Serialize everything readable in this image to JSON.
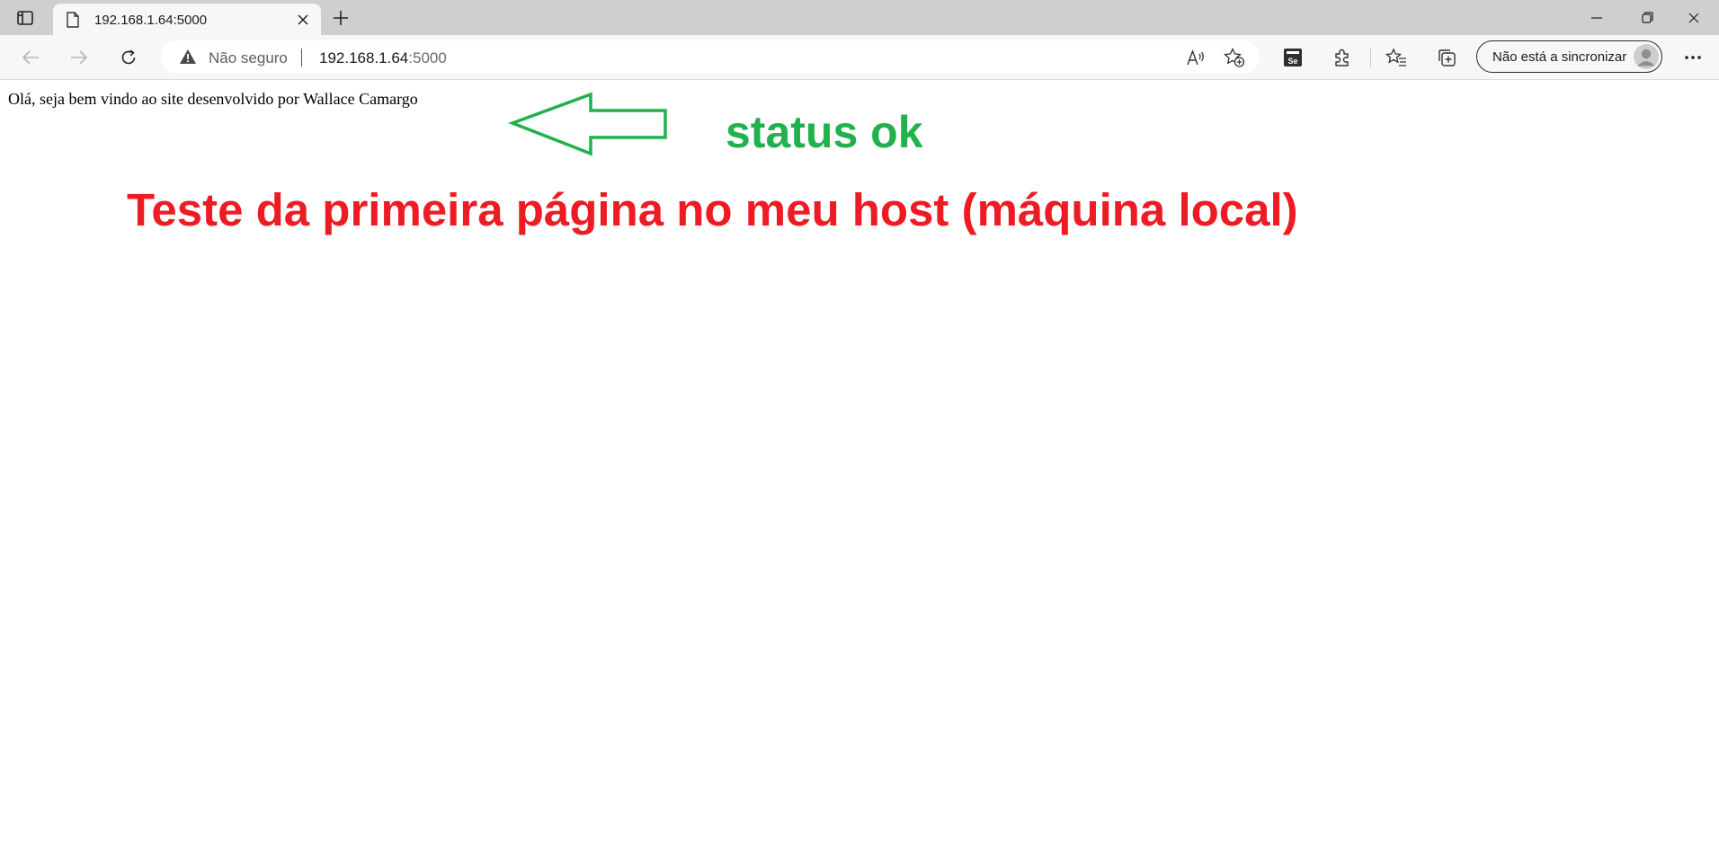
{
  "browser": {
    "tab": {
      "title": "192.168.1.64:5000"
    },
    "address_bar": {
      "security_label": "Não seguro",
      "url_host": "192.168.1.64",
      "url_port": ":5000"
    },
    "sync_button": {
      "label": "Não está a sincronizar"
    },
    "icons": {
      "tab_actions": "tab-actions-icon",
      "favicon": "page-icon",
      "tab_close": "close-icon",
      "new_tab": "plus-icon",
      "back": "back-arrow-icon",
      "forward": "forward-arrow-icon",
      "refresh": "refresh-icon",
      "warning": "warning-icon",
      "read_aloud": "read-aloud-icon",
      "add_favorite": "add-favorite-icon",
      "selenium_ext": "selenium-extension-icon",
      "extensions": "extensions-icon",
      "favorites": "favorites-icon",
      "collections": "collections-icon",
      "profile": "profile-avatar-icon",
      "more": "more-options-icon"
    }
  },
  "page": {
    "welcome_text": "Olá, seja bem vindo ao site desenvolvido por Wallace Camargo",
    "annotation_status": "status ok",
    "annotation_heading": "Teste da primeira página no meu host (máquina local)"
  },
  "colors": {
    "annotation_green": "#22b14c",
    "annotation_red": "#ed1c24"
  }
}
